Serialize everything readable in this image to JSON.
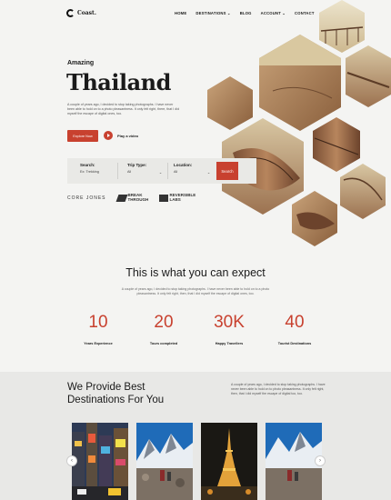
{
  "brand": {
    "name": "Coast."
  },
  "nav": [
    "HOME",
    "DESTINATIONS ⌄",
    "BLOG",
    "ACCOUNT ⌄",
    "CONTACT"
  ],
  "hero": {
    "eyebrow": "Amazing",
    "title": "Thailand",
    "text": "A couple of years ago, I decided to stop taking photographs. I have never been able to hold on to a photo pleasantness. It only felt right, there, that I did myself the escape of digital ones, too.",
    "cta_label": "Explore Now",
    "play_label": "Play a video"
  },
  "search": {
    "fields": [
      {
        "label": "Search:",
        "value": "Ex: Trekking"
      },
      {
        "label": "Trip Type:",
        "value": "All"
      },
      {
        "label": "Location:",
        "value": "All"
      }
    ],
    "button_label": "Search"
  },
  "partners": [
    "CORE JONES",
    "BREAK THROUGH",
    "REVERSIBLE LABS"
  ],
  "expect": {
    "title": "This is what you can expect",
    "text": "A couple of years ago, I decided to stop taking photographs. I have never been able to hold on to a photo pleasantness. It only felt right, then, that I did myself the escape of digital ones, too.",
    "stats": [
      {
        "value": "10",
        "label": "Years Experience"
      },
      {
        "value": "20",
        "label": "Tours completed"
      },
      {
        "value": "30K",
        "label": "Happy Travellers"
      },
      {
        "value": "40",
        "label": "Tourist Destinations"
      }
    ]
  },
  "destinations": {
    "title_line1": "We Provide Best",
    "title_line2": "Destinations For You",
    "text": "A couple of years ago, I decided to stop taking photographs. I have never been able to hold on to photo pleasantness. It only felt right, then, that I did myself the escape of digital too, too."
  },
  "colors": {
    "accent": "#c8412f",
    "band": "#e8e8e6",
    "background": "#f4f4f2"
  }
}
